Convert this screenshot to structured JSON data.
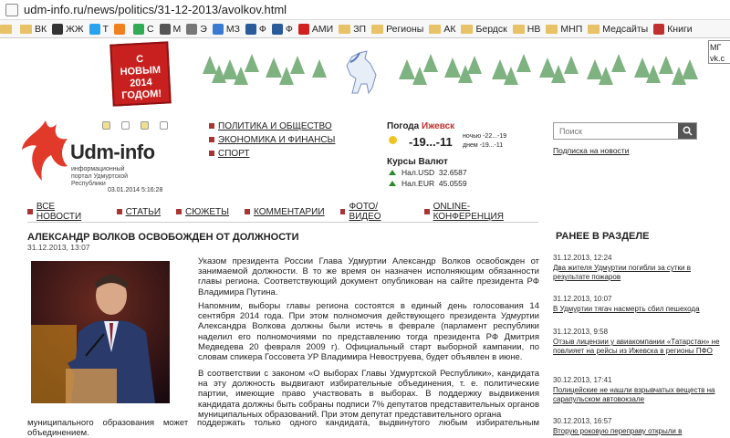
{
  "browser": {
    "url": "udm-info.ru/news/politics/31-12-2013/avolkov.html",
    "bookmarks": [
      {
        "label": "",
        "icon": "folder-icon",
        "color": "#e8c267"
      },
      {
        "label": "ВК",
        "icon": "folder-icon",
        "color": "#e8c267"
      },
      {
        "label": "ЖЖ",
        "icon": "lj-icon",
        "color": "#333333"
      },
      {
        "label": "Т",
        "icon": "twitter-icon",
        "color": "#2aa3ef"
      },
      {
        "label": "",
        "icon": "odnoklassniki-icon",
        "color": "#f08020"
      },
      {
        "label": "С",
        "icon": "c-icon",
        "color": "#3a5"
      },
      {
        "label": "М",
        "icon": "mail-icon",
        "color": "#555"
      },
      {
        "label": "Э",
        "icon": "e-icon",
        "color": "#777"
      },
      {
        "label": "МЗ",
        "icon": "mz-icon",
        "color": "#3a7ad0"
      },
      {
        "label": "Ф",
        "icon": "f-icon",
        "color": "#2a5a9a"
      },
      {
        "label": "Ф",
        "icon": "f2-icon",
        "color": "#2a5a9a"
      },
      {
        "label": "АМИ",
        "icon": "red-cross-icon",
        "color": "#d02020"
      },
      {
        "label": "ЗП",
        "icon": "folder-icon",
        "color": "#e8c267"
      },
      {
        "label": "Регионы",
        "icon": "folder-icon",
        "color": "#e8c267"
      },
      {
        "label": "АК",
        "icon": "folder-icon",
        "color": "#e8c267"
      },
      {
        "label": "Бердск",
        "icon": "folder-icon",
        "color": "#e8c267"
      },
      {
        "label": "НВ",
        "icon": "folder-icon",
        "color": "#e8c267"
      },
      {
        "label": "МНП",
        "icon": "folder-icon",
        "color": "#e8c267"
      },
      {
        "label": "Медсайты",
        "icon": "folder-icon",
        "color": "#e8c267"
      },
      {
        "label": "Книги",
        "icon": "book-icon",
        "color": "#c03030"
      }
    ],
    "tooltip": "МГ vk.c"
  },
  "banner": {
    "card_text": "С НОВЫМ 2014 ГОДОМ!",
    "card_color": "#c8201f"
  },
  "site": {
    "logo_name": "Udm-info",
    "logo_subtitle": "информационный портал Удмуртской Республики",
    "datetime": "03.01.2014 5:16:28",
    "main_nav": [
      "ПОЛИТИКА И ОБЩЕСТВО",
      "ЭКОНОМИКА И ФИНАНСЫ",
      "СПОРТ"
    ],
    "weather": {
      "title": "Погода",
      "city": "Ижевск",
      "temp": "-19...-11",
      "night": "ночью -22...-19",
      "day": "днем -19...-11"
    },
    "rates": {
      "title": "Курсы Валют",
      "items": [
        {
          "label": "Нал.USD",
          "value": "32.6587"
        },
        {
          "label": "Нал.EUR",
          "value": "45.0559"
        }
      ]
    },
    "search_placeholder": "Поиск",
    "subscribe": "Подписка на новости",
    "sub_nav": [
      "ВСЕ НОВОСТИ",
      "СТАТЬИ",
      "СЮЖЕТЫ",
      "КОММЕНТАРИИ",
      "ФОТО/ВИДЕО",
      "ONLINE-КОНФЕРЕНЦИЯ"
    ]
  },
  "article": {
    "title": "АЛЕКСАНДР ВОЛКОВ ОСВОБОЖДЕН ОТ ДОЛЖНОСТИ",
    "date": "31.12.2013, 13:07",
    "paragraphs": [
      "Указом президента России Глава Удмуртии Александр Волков освобожден от занимаемой должности. В то же время он назначен исполняющим обязанности главы региона. Соответствующий документ опубликован на сайте президента РФ Владимира Путина.",
      "Напомним, выборы главы региона состоятся в единый день голосования 14 сентября 2014 года. При этом полномочия действующего президента Удмуртии Александра Волкова должны были истечь в феврале (парламент республики наделил его полномочиями по представлению тогда президента РФ Дмитрия Медведева 20 февраля 2009 г). Официальный старт выборной кампании, по словам спикера Госсовета УР Владимира Невоструева, будет объявлен в июне.",
      "В соответствии с законом «О выборах Главы Удмуртской Республики», кандидата на эту должность выдвигают избирательные объединения, т. е. политические партии, имеющие право участвовать в выборах. В поддержку выдвижения кандидата должны быть собраны подписи 7% депутатов представительных органов муниципальных образований. При этом депутат представительного органа"
    ],
    "paragraph_tail": "муниципального образования может поддержать только одного кандидата, выдвинутого любым избирательным объединением."
  },
  "sidebar": {
    "title": "РАНЕЕ В РАЗДЕЛЕ",
    "items": [
      {
        "date": "31.12.2013, 12:24",
        "text": "Два жителя Удмуртии погибли за сутки в результате пожаров"
      },
      {
        "date": "31.12.2013, 10:07",
        "text": "В Удмуртии тягач насмерть сбил пешехода"
      },
      {
        "date": "31.12.2013, 9:58",
        "text": "Отзыв лицензии у авиакомпании «Татарстан» не повлияет на рейсы из Ижевска в регионы ПФО"
      },
      {
        "date": "30.12.2013, 17:41",
        "text": "Полицейские не нашли взрывчатых веществ на сарапульском автовокзале"
      },
      {
        "date": "30.12.2013, 16:57",
        "text": "Вторую роковую переправу открыли в"
      }
    ]
  }
}
